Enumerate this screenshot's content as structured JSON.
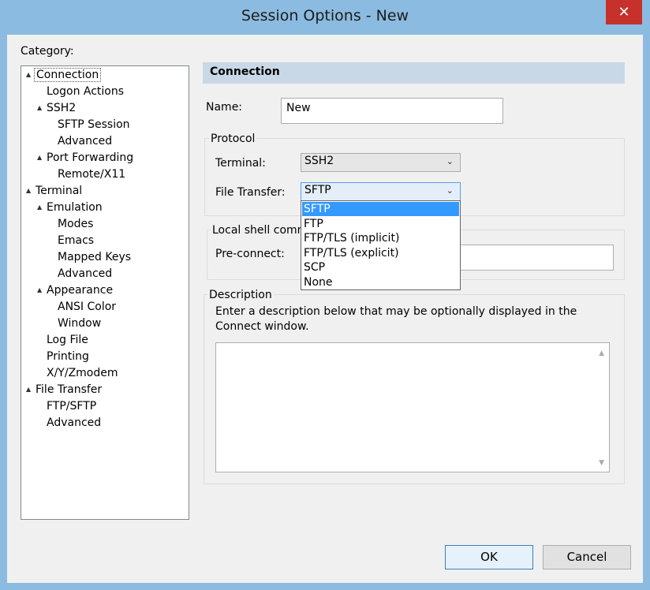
{
  "window": {
    "title": "Session Options - New",
    "close_glyph": "✕"
  },
  "category_label": "Category:",
  "tree": [
    {
      "label": "Connection",
      "expander": "▲",
      "selected": true
    },
    {
      "label": "Logon Actions",
      "expander": ""
    },
    {
      "label": "SSH2",
      "expander": "▲"
    },
    {
      "label": "SFTP Session",
      "expander": ""
    },
    {
      "label": "Advanced",
      "expander": ""
    },
    {
      "label": "Port Forwarding",
      "expander": "▲"
    },
    {
      "label": "Remote/X11",
      "expander": ""
    },
    {
      "label": "Terminal",
      "expander": "▲"
    },
    {
      "label": "Emulation",
      "expander": "▲"
    },
    {
      "label": "Modes",
      "expander": ""
    },
    {
      "label": "Emacs",
      "expander": ""
    },
    {
      "label": "Mapped Keys",
      "expander": ""
    },
    {
      "label": "Advanced",
      "expander": ""
    },
    {
      "label": "Appearance",
      "expander": "▲"
    },
    {
      "label": "ANSI Color",
      "expander": ""
    },
    {
      "label": "Window",
      "expander": ""
    },
    {
      "label": "Log File",
      "expander": ""
    },
    {
      "label": "Printing",
      "expander": ""
    },
    {
      "label": "X/Y/Zmodem",
      "expander": ""
    },
    {
      "label": "File Transfer",
      "expander": "▲"
    },
    {
      "label": "FTP/SFTP",
      "expander": ""
    },
    {
      "label": "Advanced",
      "expander": ""
    }
  ],
  "panel": {
    "header": "Connection",
    "name_label": "Name:",
    "name_value": "New",
    "protocol_group": "Protocol",
    "terminal_label": "Terminal:",
    "terminal_value": "SSH2",
    "file_transfer_label": "File Transfer:",
    "file_transfer_value": "SFTP",
    "file_transfer_options": [
      "SFTP",
      "FTP",
      "FTP/TLS (implicit)",
      "FTP/TLS (explicit)",
      "SCP",
      "None"
    ],
    "highlighted_option": 0,
    "local_shell_group": "Local shell comm",
    "preconnect_label": "Pre-connect:",
    "preconnect_value": "",
    "description_group": "Description",
    "description_text": "Enter a description below that may be optionally displayed in the Connect window.",
    "description_value": ""
  },
  "buttons": {
    "ok": "OK",
    "cancel": "Cancel"
  },
  "colors": {
    "accent": "#3399ff",
    "close": "#c7312b",
    "frame": "#8bbbe0",
    "header_band": "#c8d8e6"
  }
}
